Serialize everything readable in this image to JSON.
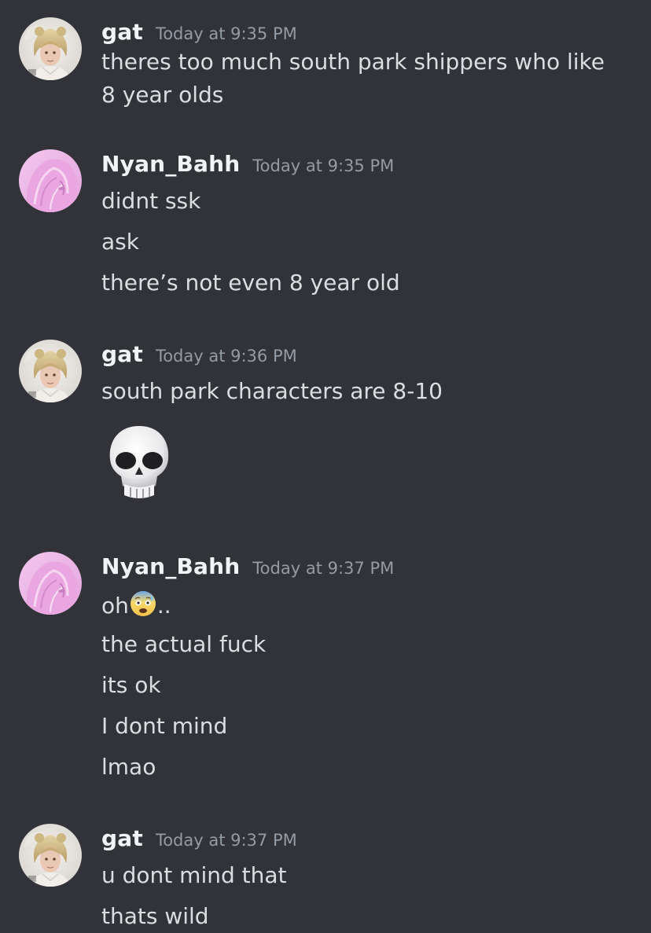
{
  "messages": [
    {
      "author": "gat",
      "timestamp": "Today at 9:35 PM",
      "avatar_icon": "blonde-doll-avatar",
      "lines": [
        "theres too much south park shippers who like 8 year olds"
      ]
    },
    {
      "author": "Nyan_Bahh",
      "timestamp": "Today at 9:35 PM",
      "avatar_icon": "pink-anime-avatar",
      "lines": [
        "didnt ssk",
        "ask",
        "there’s not even 8 year old"
      ]
    },
    {
      "author": "gat",
      "timestamp": "Today at 9:36 PM",
      "avatar_icon": "blonde-doll-avatar",
      "lines": [
        "south park characters are 8-10"
      ],
      "big_emoji": "skull-emoji"
    },
    {
      "author": "Nyan_Bahh",
      "timestamp": "Today at 9:37 PM",
      "avatar_icon": "pink-anime-avatar",
      "lines": [
        "oh",
        "..",
        "the actual fuck",
        "its ok",
        "I dont mind",
        "lmao"
      ],
      "inline_emoji": "anxious-face-with-sweat-emoji"
    },
    {
      "author": "gat",
      "timestamp": "Today at 9:37 PM",
      "avatar_icon": "blonde-doll-avatar",
      "lines": [
        "u dont mind that",
        "thats wild"
      ]
    }
  ],
  "colors": {
    "background": "#313338",
    "username": "#f2f3f5",
    "timestamp": "#949ba4",
    "message_text": "#dbdee1"
  }
}
